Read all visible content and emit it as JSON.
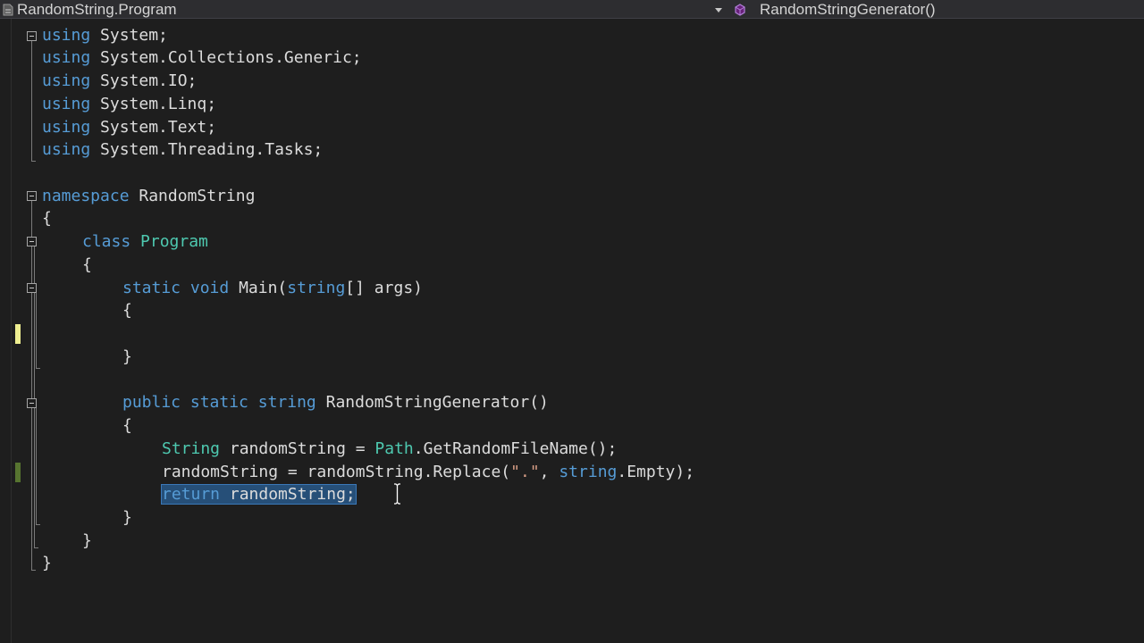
{
  "navbar": {
    "type_dropdown": "RandomString.Program",
    "member_dropdown": "RandomStringGenerator()"
  },
  "code": {
    "l1": {
      "kw": "using",
      "rest": " System;"
    },
    "l2": {
      "kw": "using",
      "rest": " System.Collections.Generic;"
    },
    "l3": {
      "kw": "using",
      "rest": " System.IO;"
    },
    "l4": {
      "kw": "using",
      "rest": " System.Linq;"
    },
    "l5": {
      "kw": "using",
      "rest": " System.Text;"
    },
    "l6": {
      "kw": "using",
      "rest": " System.Threading.Tasks;"
    },
    "l8": {
      "kw": "namespace",
      "rest": " RandomString"
    },
    "l9": {
      "brace": "{"
    },
    "l10": {
      "kw": "class",
      "type": "Program"
    },
    "l11": {
      "brace": "{"
    },
    "l12": {
      "kw1": "static",
      "kw2": "void",
      "name": "Main(",
      "type": "string",
      "rest": "[] args)"
    },
    "l13": {
      "brace": "{"
    },
    "l15": {
      "brace": "}"
    },
    "l17": {
      "kw1": "public",
      "kw2": "static",
      "kw3": "string",
      "name": "RandomStringGenerator()"
    },
    "l18": {
      "brace": "{"
    },
    "l19": {
      "type1": "String",
      "mid": " randomString = ",
      "type2": "Path",
      "rest": ".GetRandomFileName();"
    },
    "l20": {
      "pre": "randomString = randomString.Replace(",
      "str": "\".\"",
      "mid": ", ",
      "kw": "string",
      "rest": ".Empty);"
    },
    "l21": {
      "kw": "return",
      "rest": " randomString;"
    },
    "l22": {
      "brace": "}"
    },
    "l23": {
      "brace": "}"
    },
    "l24": {
      "brace": "}"
    }
  },
  "colors": {
    "background": "#1e1e1e",
    "keyword": "#569cd6",
    "type": "#4ec9b0",
    "text": "#dcdcdc",
    "string": "#d69d85",
    "selection": "#264f78",
    "change_unsaved": "#efef91",
    "change_saved": "#577430"
  },
  "icons": {
    "type_icon": "csharp-file-icon",
    "member_icon": "method-icon",
    "cursor": "i-beam-cursor-icon"
  }
}
